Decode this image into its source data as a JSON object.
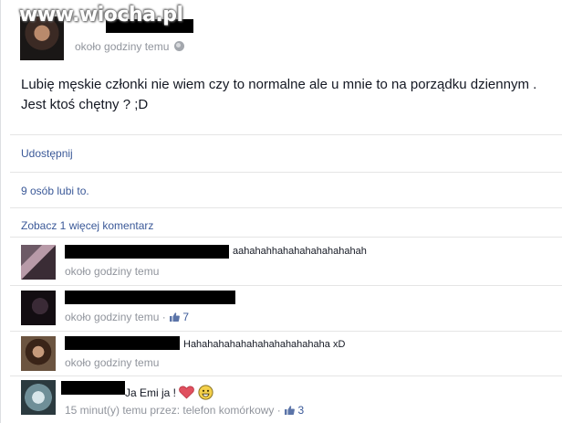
{
  "watermark": "www.wiocha.pl",
  "post": {
    "time": "około godziny temu",
    "text": "Lubię męskie członki nie wiem czy to normalne ale u mnie to na porządku dziennym . Jest ktoś chętny ? ;D",
    "share_label": "Udostępnij",
    "likes_text": "9 osób lubi to.",
    "more_comments_label": "Zobacz 1 więcej komentarz"
  },
  "comments": [
    {
      "text": "aahahahhahahahahahahahah",
      "meta": "około godziny temu",
      "likes": ""
    },
    {
      "text": "",
      "meta": "około godziny temu · ",
      "likes": "7"
    },
    {
      "text": "Hahahahahahahahahahahahaha xD",
      "meta": "około godziny temu",
      "likes": ""
    },
    {
      "text": "Ja Emi ja !",
      "meta": "15 minut(y) temu przez: telefon komórkowy · ",
      "likes": "3"
    }
  ],
  "colors": {
    "link": "#3b5998",
    "meta": "#90949c",
    "heart": "#e0505f"
  },
  "icons": [
    "globe-icon",
    "thumb-up-icon",
    "heart-icon",
    "smile-icon"
  ]
}
